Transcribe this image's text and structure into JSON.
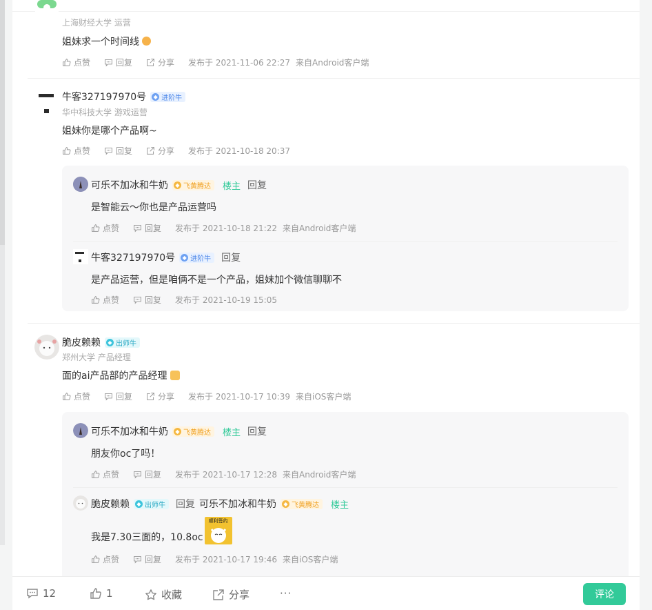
{
  "actions": {
    "like": "点赞",
    "reply": "回复",
    "share": "分享"
  },
  "comments": [
    {
      "user": {
        "name": "",
        "school": "上海财经大学 运营"
      },
      "content": "姐妹求一个时间线",
      "time": "发布于 2021-11-06 22:27",
      "source": "来自Android客户端"
    },
    {
      "user": {
        "name": "牛客327197970号",
        "badge": "进阶牛",
        "school": "华中科技大学 游戏运营"
      },
      "content": "姐妹你是哪个产品啊~",
      "time": "发布于 2021-10-18 20:37",
      "replies": [
        {
          "name": "可乐不加冰和牛奶",
          "badge": "飞黄腾达",
          "owner_tag": "楼主",
          "reply_label": "回复",
          "content": "是智能云～你也是产品运营吗",
          "time": "发布于 2021-10-18 21:22",
          "source": "来自Android客户端"
        },
        {
          "name": "牛客327197970号",
          "badge": "进阶牛",
          "reply_label": "回复",
          "content": "是产品运营，但是咱俩不是一个产品，姐妹加个微信聊聊不",
          "time": "发布于 2021-10-19 15:05"
        }
      ]
    },
    {
      "user": {
        "name": "脆皮赖赖",
        "badge": "出师牛",
        "school": "郑州大学 产品经理"
      },
      "content": "面的ai产品部的产品经理",
      "time": "发布于 2021-10-17 10:39",
      "source": "来自iOS客户端",
      "replies": [
        {
          "name": "可乐不加冰和牛奶",
          "badge": "飞黄腾达",
          "owner_tag": "楼主",
          "reply_label": "回复",
          "content": "朋友你oc了吗！",
          "time": "发布于 2021-10-17 12:28",
          "source": "来自Android客户端"
        },
        {
          "name": "脆皮赖赖",
          "badge": "出师牛",
          "reply_label": "回复",
          "target_name": "可乐不加冰和牛奶",
          "target_badge": "飞黄腾达",
          "target_owner_tag": "楼主",
          "content": "我是7.30三面的，10.8oc",
          "sticker_text": "顺利签约",
          "time": "发布于 2021-10-17 19:46",
          "source": "来自iOS客户端"
        }
      ]
    }
  ],
  "bottom_bar": {
    "comments_count": "12",
    "likes_count": "1",
    "favorite_label": "收藏",
    "share_label": "分享",
    "more_label": "···",
    "comment_button": "评论"
  },
  "colors": {
    "accent": "#32ca99",
    "badge_blue": "#4d87e8",
    "badge_cyan": "#2aa9c4",
    "badge_gold": "#f0a020"
  },
  "icons": [
    "like-icon",
    "reply-icon",
    "share-icon",
    "comment-icon",
    "star-icon",
    "more-icon"
  ]
}
